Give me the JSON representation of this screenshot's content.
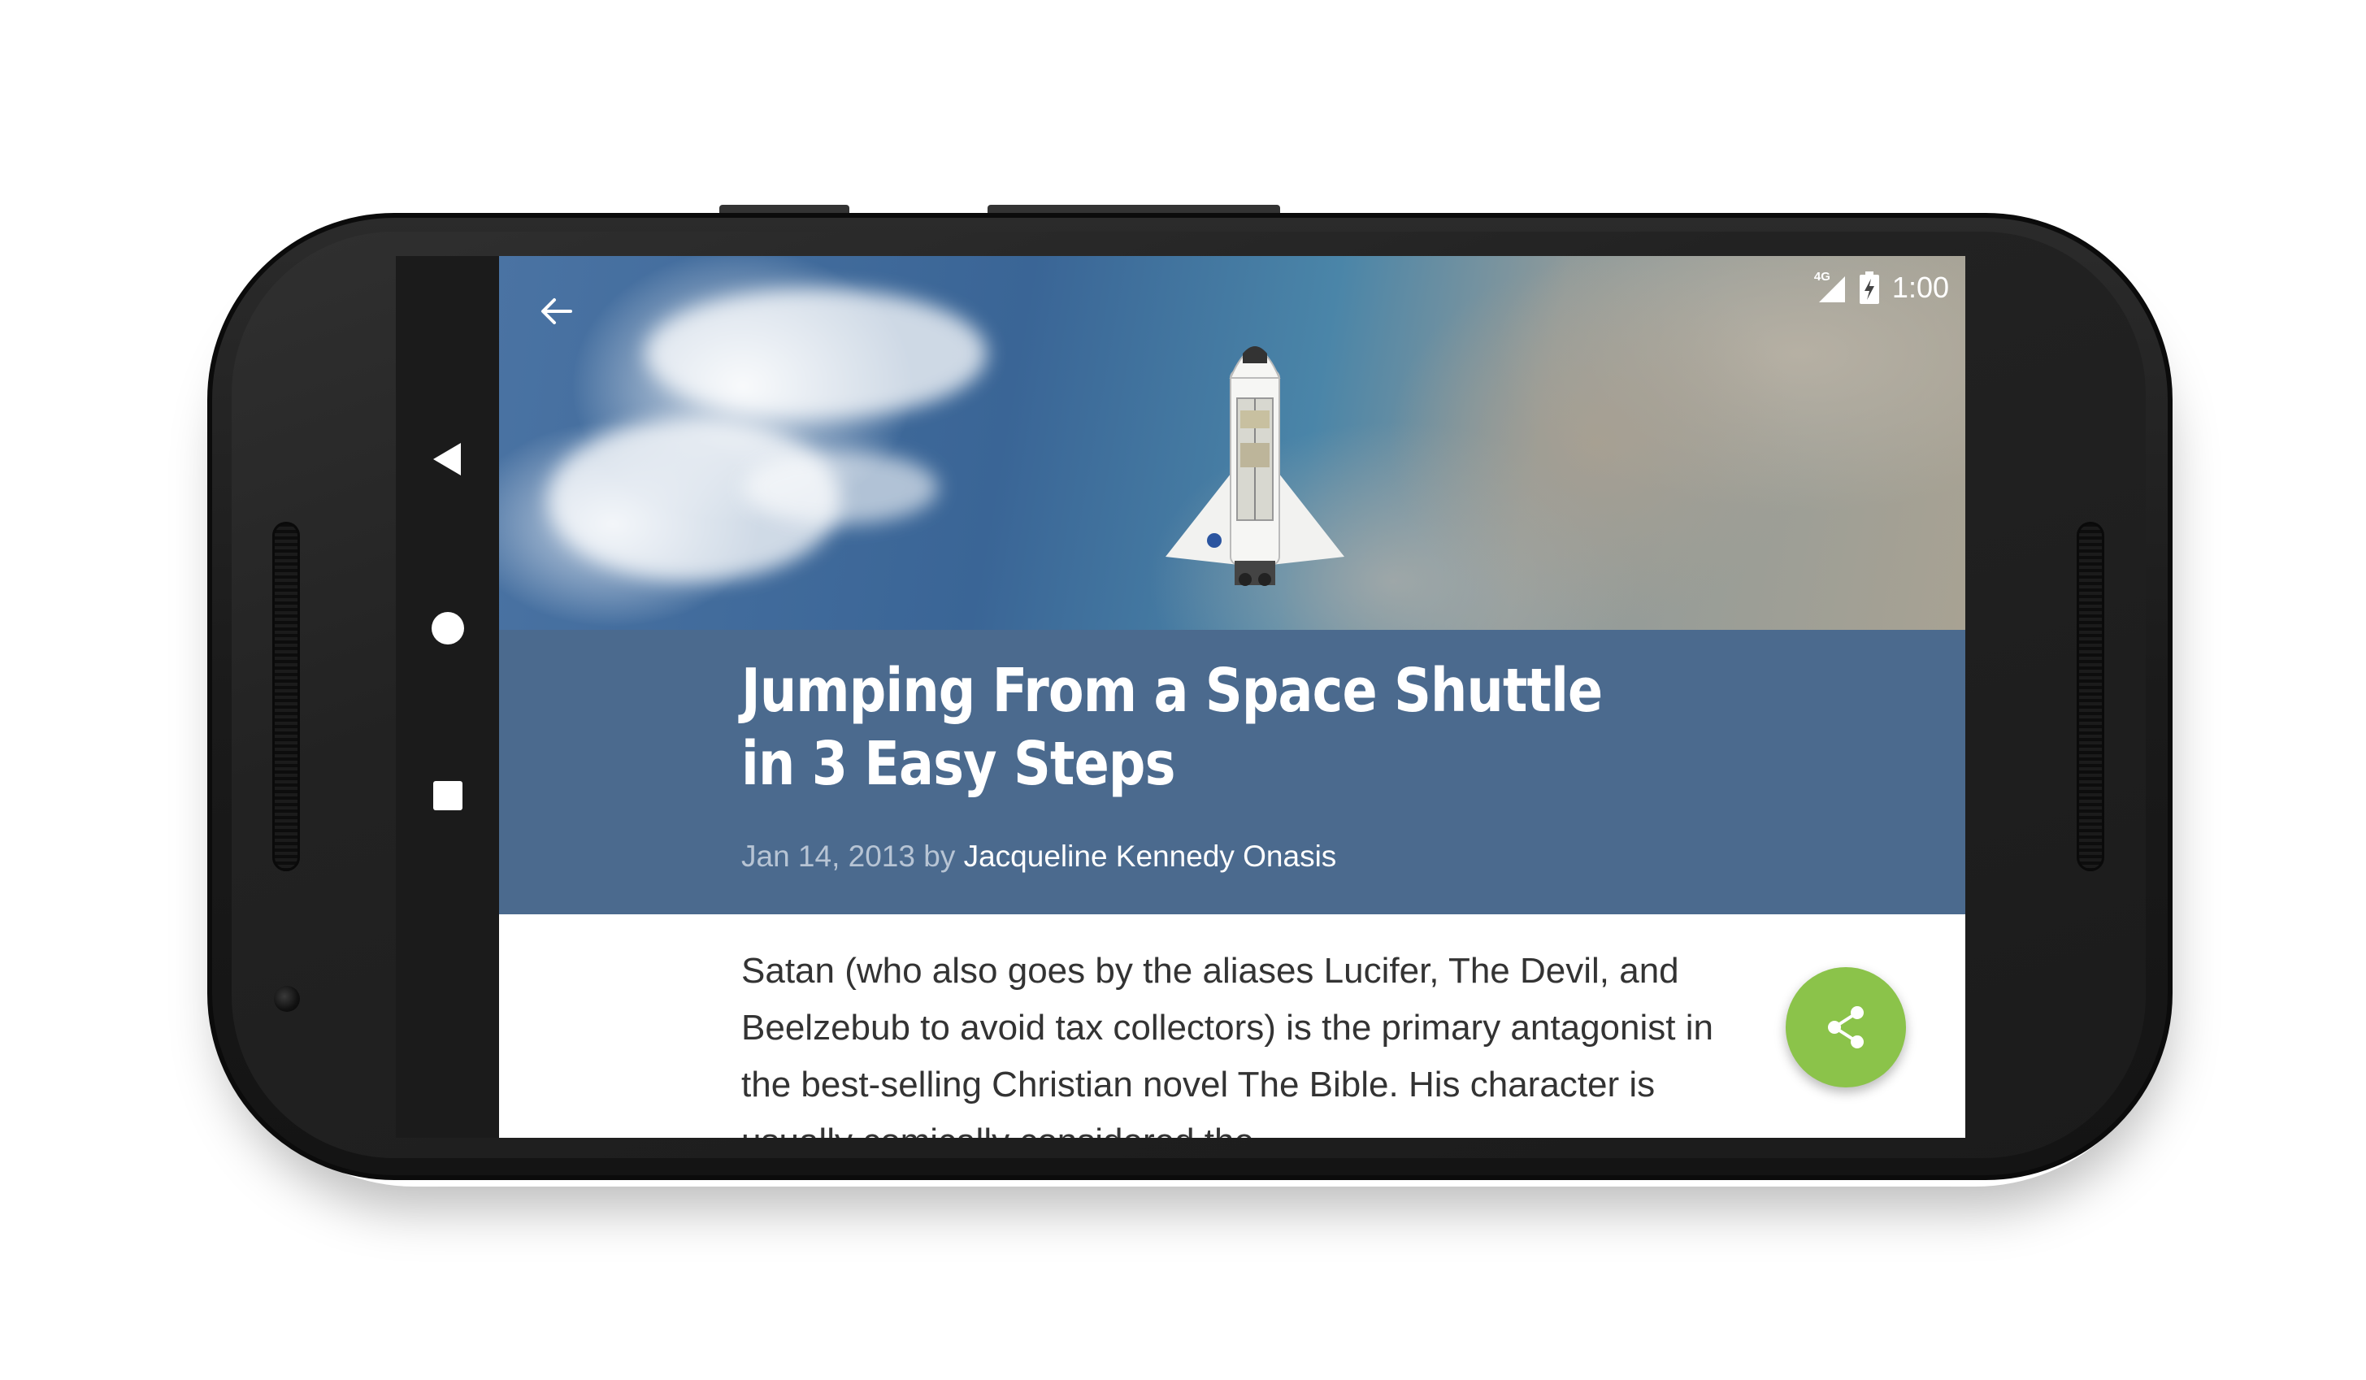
{
  "device": {
    "nav_buttons": {
      "back": "triangle-back-icon",
      "home": "circle-home-icon",
      "recents": "square-recents-icon"
    }
  },
  "status_bar": {
    "network": "4G",
    "time": "1:00"
  },
  "toolbar": {
    "back_icon": "arrow-back-icon"
  },
  "article": {
    "title": "Jumping From a Space Shuttle in 3 Easy Steps",
    "date": "Jan 14, 2013",
    "by": "by",
    "author": "Jacqueline Kennedy Onasis",
    "body": "Satan (who also goes by the aliases Lucifer, The Devil, and Beelzebub to avoid tax collectors) is the primary antagonist in the best-selling Christian novel The Bible. His character is usually comically considered the"
  },
  "fab": {
    "icon": "share-icon"
  },
  "colors": {
    "header_band": "#4b6a8e",
    "fab": "#8bc34a",
    "meta_text": "#b7c4d4"
  }
}
